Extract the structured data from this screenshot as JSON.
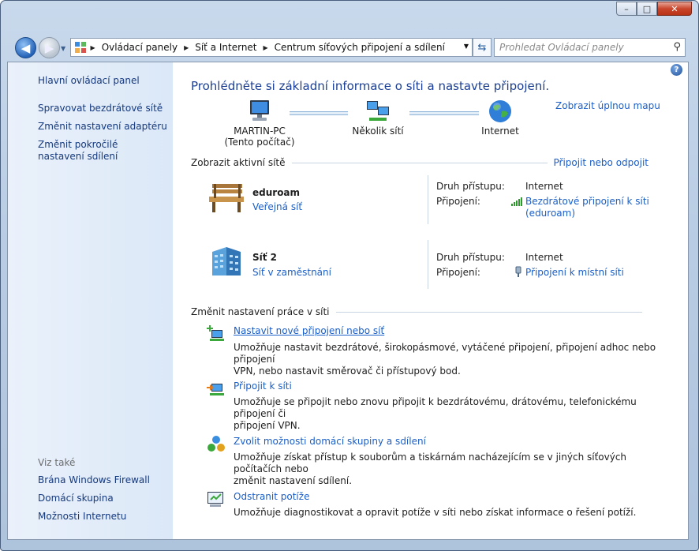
{
  "window": {
    "minimize_label": "–",
    "maximize_label": "□",
    "close_label": "✕"
  },
  "address_bar": {
    "crumbs": [
      "Ovládací panely",
      "Síť a Internet",
      "Centrum síťových připojení a sdílení"
    ]
  },
  "search": {
    "placeholder": "Prohledat Ovládací panely"
  },
  "sidebar": {
    "home": "Hlavní ovládací panel",
    "tasks": [
      "Spravovat bezdrátové sítě",
      "Změnit nastavení adaptéru",
      "Změnit pokročilé nastavení sdílení"
    ],
    "see_also_title": "Viz také",
    "see_also": [
      "Brána Windows Firewall",
      "Domácí skupina",
      "Možnosti Internetu"
    ]
  },
  "main": {
    "heading": "Prohlédněte si základní informace o síti a nastavte připojení.",
    "full_map_link": "Zobrazit úplnou mapu",
    "map": {
      "computer": {
        "name": "MARTIN-PC",
        "sub": "(Tento počítač)"
      },
      "networks": "Několik sítí",
      "internet": "Internet"
    },
    "active_title": "Zobrazit aktivní sítě",
    "connect_link": "Připojit nebo odpojit",
    "access_type_label": "Druh přístupu:",
    "connection_label": "Připojení:",
    "active_networks": [
      {
        "name": "eduroam",
        "type": "Veřejná síť",
        "access": "Internet",
        "connection_lines": [
          "Bezdrátové připojení k síti",
          "(eduroam)"
        ]
      },
      {
        "name": "Síť  2",
        "type": "Síť v zaměstnání",
        "access": "Internet",
        "connection_lines": [
          "Připojení k místní síti"
        ]
      }
    ],
    "settings_title": "Změnit nastavení práce v síti",
    "tasks": [
      {
        "title": "Nastavit nové připojení nebo síť",
        "desc_lines": [
          "Umožňuje nastavit bezdrátové, širokopásmové, vytáčené připojení, připojení adhoc nebo připojení",
          "VPN, nebo nastavit směrovač či přístupový bod."
        ]
      },
      {
        "title": "Připojit k síti",
        "desc_lines": [
          "Umožňuje se připojit nebo znovu připojit k bezdrátovému, drátovému, telefonickému připojení či",
          "připojení VPN."
        ]
      },
      {
        "title": "Zvolit možnosti domácí skupiny a sdílení",
        "desc_lines": [
          "Umožňuje získat přístup k souborům a tiskárnám nacházejícím se v jiných síťových počítačích nebo",
          "změnit nastavení sdílení."
        ]
      },
      {
        "title": "Odstranit potíže",
        "desc_lines": [
          "Umožňuje diagnostikovat a opravit potíže v síti nebo získat informace o řešení potíží."
        ]
      }
    ]
  }
}
